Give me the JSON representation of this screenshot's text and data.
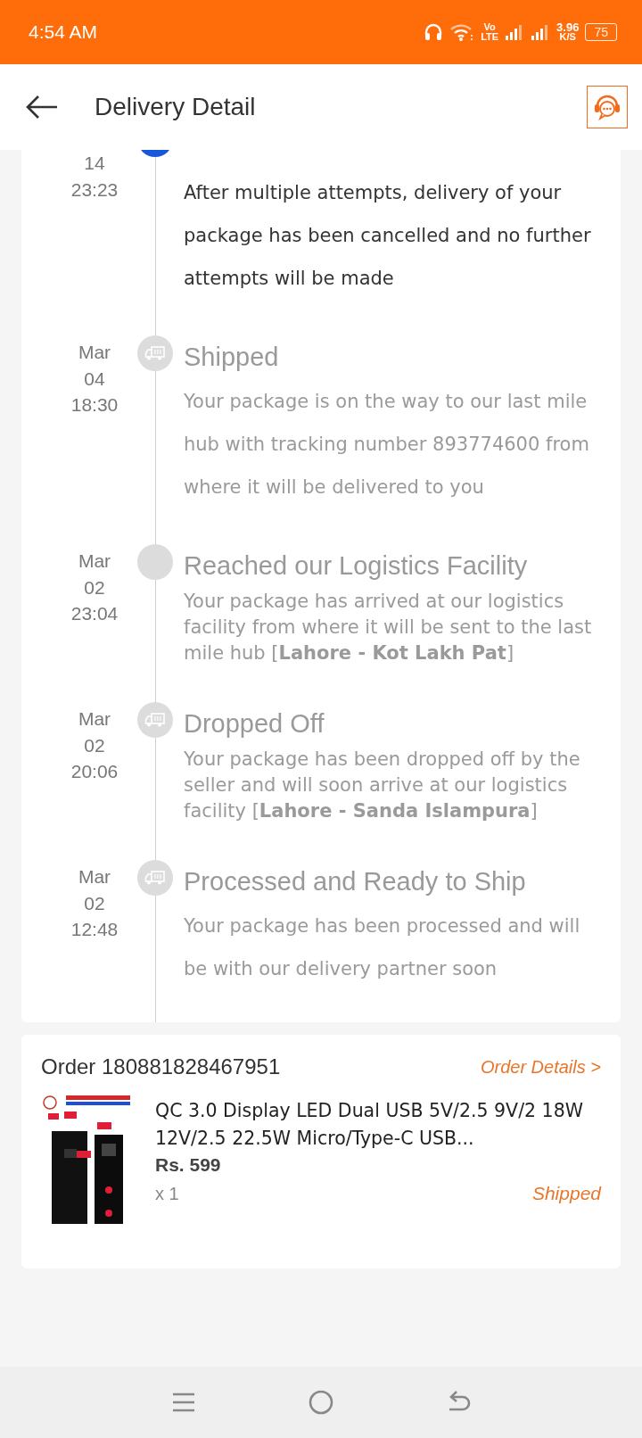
{
  "status_bar": {
    "time": "4:54 AM",
    "network_top": "Vo",
    "network_bottom": "LTE",
    "speed": "3.96",
    "speed_unit": "K/S",
    "battery": "75"
  },
  "header": {
    "title": "Delivery Detail"
  },
  "events": [
    {
      "date": [
        "14",
        "23:23"
      ],
      "current": true,
      "kind": "notice",
      "description": "After multiple attempts, delivery of your package has been cancelled and no further attempts will be made"
    },
    {
      "date": [
        "Mar",
        "04",
        "18:30"
      ],
      "current": false,
      "kind": "transit",
      "title": "Shipped",
      "description": "Your package is on the way to our last mile hub with tracking number 893774600 from where it will be delivered to you"
    },
    {
      "date": [
        "Mar",
        "02",
        "23:04"
      ],
      "current": false,
      "kind": "facility",
      "title": "Reached our Logistics Facility",
      "description": "Your package has arrived at our logistics facility from where it will be sent to the last mile hub [**Lahore - Kot Lakh Pat**]"
    },
    {
      "date": [
        "Mar",
        "02",
        "20:06"
      ],
      "current": false,
      "kind": "handover",
      "title": "Dropped Off",
      "description": "Your package has been dropped off by the seller and will soon arrive at our logistics facility [**Lahore - Sanda Islampura**]"
    },
    {
      "date": [
        "Mar",
        "02",
        "12:48"
      ],
      "current": false,
      "kind": "processing",
      "title": "Processed and Ready to Ship",
      "description": "Your package has been processed and will be with our delivery partner soon"
    }
  ],
  "order": {
    "number": "Order 180881828467951",
    "details_link": "Order Details >",
    "product": {
      "kind": "picture",
      "title": "QC 3.0 Display LED Dual USB 5V/2.5 9V/2 18W 12V/2.5 22.5W Micro/Type-C USB...",
      "price": "Rs. 599",
      "quantity": "x 1",
      "status": "Shipped"
    }
  }
}
